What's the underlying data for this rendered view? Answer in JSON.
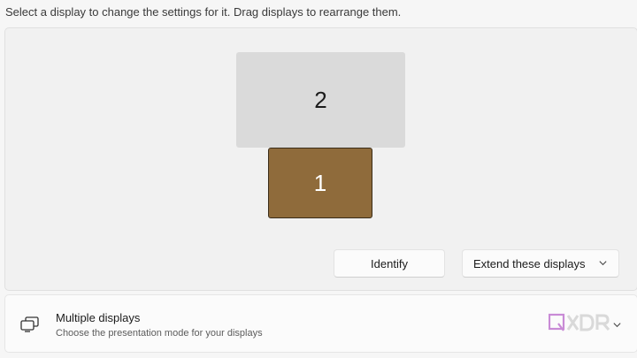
{
  "instruction": "Select a display to change the settings for it. Drag displays to rearrange them.",
  "displays": [
    {
      "label": "2",
      "color": "#dadada"
    },
    {
      "label": "1",
      "color": "#8f6b3b",
      "selected": true
    }
  ],
  "actions": {
    "identify_label": "Identify",
    "mode_value": "Extend these displays"
  },
  "multiple_displays": {
    "title": "Multiple displays",
    "subtitle": "Choose the presentation mode for your displays",
    "icon": "multiple-displays-icon"
  },
  "watermark": {
    "text": "XDR",
    "brand_color": "#c98bd6"
  }
}
